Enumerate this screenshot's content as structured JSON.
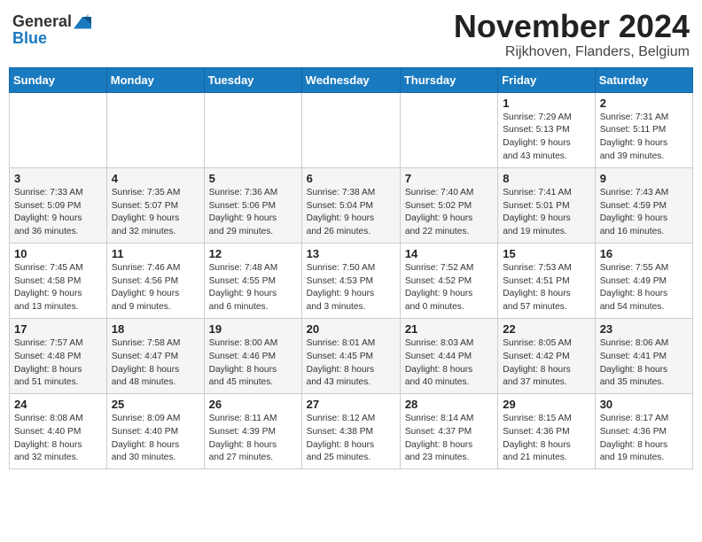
{
  "logo": {
    "text_general": "General",
    "text_blue": "Blue"
  },
  "header": {
    "month": "November 2024",
    "location": "Rijkhoven, Flanders, Belgium"
  },
  "days_of_week": [
    "Sunday",
    "Monday",
    "Tuesday",
    "Wednesday",
    "Thursday",
    "Friday",
    "Saturday"
  ],
  "weeks": [
    [
      {
        "day": "",
        "info": ""
      },
      {
        "day": "",
        "info": ""
      },
      {
        "day": "",
        "info": ""
      },
      {
        "day": "",
        "info": ""
      },
      {
        "day": "",
        "info": ""
      },
      {
        "day": "1",
        "info": "Sunrise: 7:29 AM\nSunset: 5:13 PM\nDaylight: 9 hours\nand 43 minutes."
      },
      {
        "day": "2",
        "info": "Sunrise: 7:31 AM\nSunset: 5:11 PM\nDaylight: 9 hours\nand 39 minutes."
      }
    ],
    [
      {
        "day": "3",
        "info": "Sunrise: 7:33 AM\nSunset: 5:09 PM\nDaylight: 9 hours\nand 36 minutes."
      },
      {
        "day": "4",
        "info": "Sunrise: 7:35 AM\nSunset: 5:07 PM\nDaylight: 9 hours\nand 32 minutes."
      },
      {
        "day": "5",
        "info": "Sunrise: 7:36 AM\nSunset: 5:06 PM\nDaylight: 9 hours\nand 29 minutes."
      },
      {
        "day": "6",
        "info": "Sunrise: 7:38 AM\nSunset: 5:04 PM\nDaylight: 9 hours\nand 26 minutes."
      },
      {
        "day": "7",
        "info": "Sunrise: 7:40 AM\nSunset: 5:02 PM\nDaylight: 9 hours\nand 22 minutes."
      },
      {
        "day": "8",
        "info": "Sunrise: 7:41 AM\nSunset: 5:01 PM\nDaylight: 9 hours\nand 19 minutes."
      },
      {
        "day": "9",
        "info": "Sunrise: 7:43 AM\nSunset: 4:59 PM\nDaylight: 9 hours\nand 16 minutes."
      }
    ],
    [
      {
        "day": "10",
        "info": "Sunrise: 7:45 AM\nSunset: 4:58 PM\nDaylight: 9 hours\nand 13 minutes."
      },
      {
        "day": "11",
        "info": "Sunrise: 7:46 AM\nSunset: 4:56 PM\nDaylight: 9 hours\nand 9 minutes."
      },
      {
        "day": "12",
        "info": "Sunrise: 7:48 AM\nSunset: 4:55 PM\nDaylight: 9 hours\nand 6 minutes."
      },
      {
        "day": "13",
        "info": "Sunrise: 7:50 AM\nSunset: 4:53 PM\nDaylight: 9 hours\nand 3 minutes."
      },
      {
        "day": "14",
        "info": "Sunrise: 7:52 AM\nSunset: 4:52 PM\nDaylight: 9 hours\nand 0 minutes."
      },
      {
        "day": "15",
        "info": "Sunrise: 7:53 AM\nSunset: 4:51 PM\nDaylight: 8 hours\nand 57 minutes."
      },
      {
        "day": "16",
        "info": "Sunrise: 7:55 AM\nSunset: 4:49 PM\nDaylight: 8 hours\nand 54 minutes."
      }
    ],
    [
      {
        "day": "17",
        "info": "Sunrise: 7:57 AM\nSunset: 4:48 PM\nDaylight: 8 hours\nand 51 minutes."
      },
      {
        "day": "18",
        "info": "Sunrise: 7:58 AM\nSunset: 4:47 PM\nDaylight: 8 hours\nand 48 minutes."
      },
      {
        "day": "19",
        "info": "Sunrise: 8:00 AM\nSunset: 4:46 PM\nDaylight: 8 hours\nand 45 minutes."
      },
      {
        "day": "20",
        "info": "Sunrise: 8:01 AM\nSunset: 4:45 PM\nDaylight: 8 hours\nand 43 minutes."
      },
      {
        "day": "21",
        "info": "Sunrise: 8:03 AM\nSunset: 4:44 PM\nDaylight: 8 hours\nand 40 minutes."
      },
      {
        "day": "22",
        "info": "Sunrise: 8:05 AM\nSunset: 4:42 PM\nDaylight: 8 hours\nand 37 minutes."
      },
      {
        "day": "23",
        "info": "Sunrise: 8:06 AM\nSunset: 4:41 PM\nDaylight: 8 hours\nand 35 minutes."
      }
    ],
    [
      {
        "day": "24",
        "info": "Sunrise: 8:08 AM\nSunset: 4:40 PM\nDaylight: 8 hours\nand 32 minutes."
      },
      {
        "day": "25",
        "info": "Sunrise: 8:09 AM\nSunset: 4:40 PM\nDaylight: 8 hours\nand 30 minutes."
      },
      {
        "day": "26",
        "info": "Sunrise: 8:11 AM\nSunset: 4:39 PM\nDaylight: 8 hours\nand 27 minutes."
      },
      {
        "day": "27",
        "info": "Sunrise: 8:12 AM\nSunset: 4:38 PM\nDaylight: 8 hours\nand 25 minutes."
      },
      {
        "day": "28",
        "info": "Sunrise: 8:14 AM\nSunset: 4:37 PM\nDaylight: 8 hours\nand 23 minutes."
      },
      {
        "day": "29",
        "info": "Sunrise: 8:15 AM\nSunset: 4:36 PM\nDaylight: 8 hours\nand 21 minutes."
      },
      {
        "day": "30",
        "info": "Sunrise: 8:17 AM\nSunset: 4:36 PM\nDaylight: 8 hours\nand 19 minutes."
      }
    ]
  ]
}
